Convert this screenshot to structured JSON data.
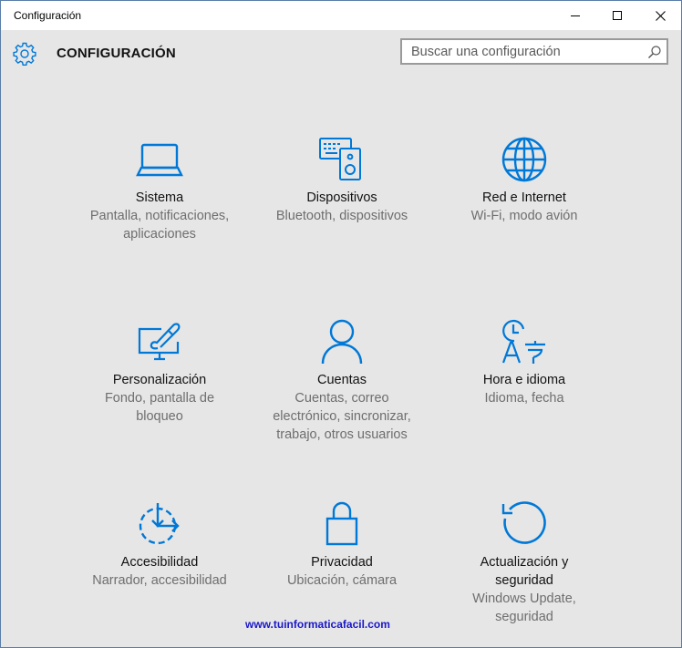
{
  "window": {
    "title": "Configuración"
  },
  "header": {
    "title": "CONFIGURACIÓN",
    "search_placeholder": "Buscar una configuración"
  },
  "tiles": [
    {
      "name": "Sistema",
      "desc": [
        "Pantalla, notificaciones,",
        "aplicaciones"
      ],
      "icon": "laptop-icon"
    },
    {
      "name": "Dispositivos",
      "desc": [
        "Bluetooth, dispositivos"
      ],
      "icon": "devices-icon"
    },
    {
      "name": "Red e Internet",
      "desc": [
        "Wi-Fi, modo avión"
      ],
      "icon": "globe-icon"
    },
    {
      "name": "Personalización",
      "desc": [
        "Fondo, pantalla de",
        "bloqueo"
      ],
      "icon": "paint-monitor-icon"
    },
    {
      "name": "Cuentas",
      "desc": [
        "Cuentas, correo",
        "electrónico, sincronizar,",
        "trabajo, otros usuarios"
      ],
      "icon": "person-icon"
    },
    {
      "name": "Hora e idioma",
      "desc": [
        "Idioma, fecha"
      ],
      "icon": "time-language-icon"
    },
    {
      "name": "Accesibilidad",
      "desc": [
        "Narrador, accesibilidad"
      ],
      "icon": "ease-of-access-icon"
    },
    {
      "name": "Privacidad",
      "desc": [
        "Ubicación, cámara"
      ],
      "icon": "lock-icon"
    },
    {
      "name": "Actualización y seguridad",
      "name_lines": [
        "Actualización y",
        "seguridad"
      ],
      "desc": [
        "Windows Update,",
        "seguridad"
      ],
      "icon": "refresh-icon"
    }
  ],
  "watermark": "www.tuinformaticafacil.com",
  "colors": {
    "accent": "#0078d7",
    "background": "#e6e6e6",
    "watermark": "#1a18c8"
  }
}
